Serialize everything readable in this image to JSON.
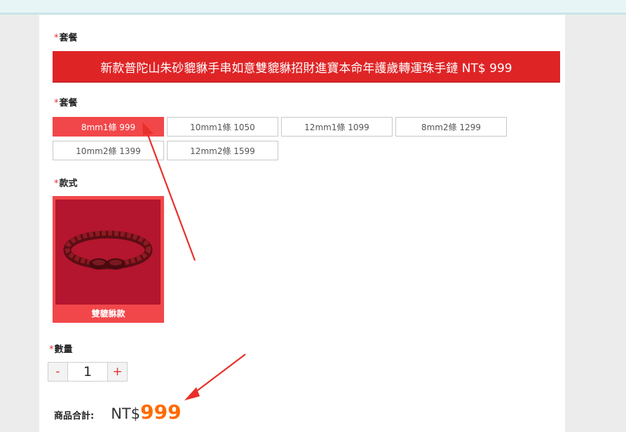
{
  "package_label_1": "套餐",
  "banner_title": "新款普陀山朱砂貔貅手串如意雙貔貅招財進寶本命年護歲轉運珠手鏈 NT$ 999",
  "package_label_2": "套餐",
  "package_options": [
    {
      "label": "8mm1條 999",
      "selected": true
    },
    {
      "label": "10mm1條 1050",
      "selected": false
    },
    {
      "label": "12mm1條 1099",
      "selected": false
    },
    {
      "label": "8mm2條 1299",
      "selected": false
    },
    {
      "label": "10mm2條 1399",
      "selected": false
    },
    {
      "label": "12mm2條 1599",
      "selected": false
    }
  ],
  "style_label": "款式",
  "style_option": {
    "caption": "雙貔貅款",
    "selected": true
  },
  "quantity_label": "數量",
  "quantity": {
    "minus": "-",
    "value": "1",
    "plus": "+"
  },
  "total": {
    "label": "商品合計:",
    "currency": "NT$",
    "amount": "999"
  },
  "required_mark": "*",
  "colors": {
    "accent": "#df2426",
    "selected_option": "#f2474a",
    "price": "#ff6a00",
    "annotation_arrow": "#e8302a"
  }
}
